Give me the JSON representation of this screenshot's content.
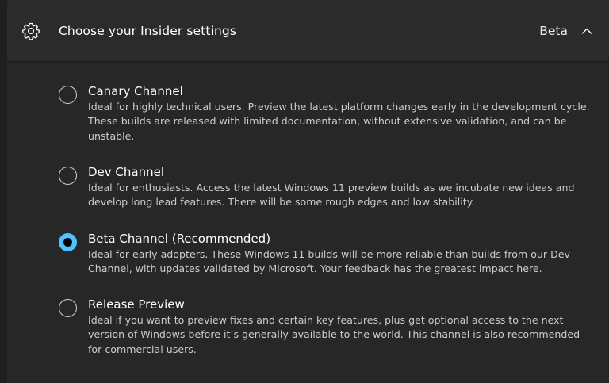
{
  "header": {
    "title": "Choose your Insider settings",
    "current_value": "Beta",
    "icon": "gear-icon",
    "expand_icon": "chevron-up-icon"
  },
  "options": [
    {
      "title": "Canary Channel",
      "description": "Ideal for highly technical users. Preview the latest platform changes early in the development cycle. These builds are released with limited documentation, without extensive validation, and can be unstable.",
      "selected": false
    },
    {
      "title": "Dev Channel",
      "description": "Ideal for enthusiasts. Access the latest Windows 11 preview builds as we incubate new ideas and develop long lead features. There will be some rough edges and low stability.",
      "selected": false
    },
    {
      "title": "Beta Channel (Recommended)",
      "description": "Ideal for early adopters. These Windows 11 builds will be more reliable than builds from our Dev Channel, with updates validated by Microsoft. Your feedback has the greatest impact here.",
      "selected": true
    },
    {
      "title": "Release Preview",
      "description": "Ideal if you want to preview fixes and certain key features, plus get optional access to the next version of Windows before it’s generally available to the world. This channel is also recommended for commercial users.",
      "selected": false
    }
  ],
  "colors": {
    "accent": "#4cc2ff",
    "header_bg": "#2b2b2b",
    "body_bg": "#272727"
  }
}
